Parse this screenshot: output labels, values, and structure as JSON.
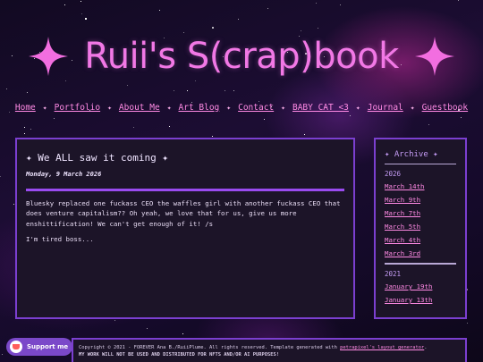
{
  "site": {
    "title": "Ruii's S(crap)book",
    "accent_pink": "#ff8ae4",
    "accent_purple": "#7b3fd0"
  },
  "nav": {
    "items": [
      "Home",
      "Portfolio",
      "About Me",
      "Art Blog",
      "Contact",
      "BABY CAT <3",
      "Journal",
      "Guestbook"
    ],
    "separator": "✦"
  },
  "post": {
    "title": "✦ We ALL saw it coming ✦",
    "date": "Monday, 9 March 2026",
    "paragraphs": [
      "Bluesky replaced one fuckass CEO the waffles girl with another fuckass CEO that does venture capitalism?? Oh yeah, we love that for us, give us more enshittification! We can't get enough of it! /s",
      "I'm tired boss..."
    ]
  },
  "archive": {
    "title": "✦ Archive ✦",
    "years": [
      {
        "year": "2026",
        "months": [
          "March 14th",
          "March 9th",
          "March 7th",
          "March 5th",
          "March 4th",
          "March 3rd"
        ]
      },
      {
        "year": "2021",
        "months": [
          "January 19th",
          "January 13th"
        ]
      }
    ]
  },
  "footer": {
    "copyright": "Copyright © 2021 - FOREVER Ana B./RuiiPlume. All rights reserved. Template generated with",
    "link": "petrapixel's layout generator",
    "period": ".",
    "warning": "MY WORK WILL NOT BE USED AND DISTRIBUTED FOR NFTS AND/OR AI PURPOSES!"
  },
  "support_button": {
    "label": "Support me",
    "icon": "kofi-cup-icon"
  }
}
